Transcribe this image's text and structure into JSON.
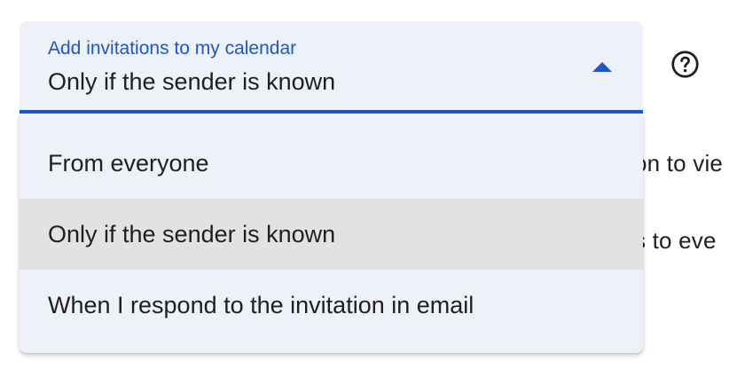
{
  "setting": {
    "label": "Add invitations to my calendar",
    "selected_value": "Only if the sender is known",
    "options": [
      "From everyone",
      "Only if the sender is known",
      "When I respond to the invitation in email"
    ]
  },
  "background": {
    "line_1": "on to vie",
    "line_2": "s to eve"
  },
  "icons": {
    "help": "help-circle-icon",
    "caret": "arrow-drop-up-icon"
  },
  "colors": {
    "accent": "#1d56c9",
    "field_background": "#eef1f8",
    "selected_option_background": "#e1e2e1",
    "text": "#1f1f1f"
  }
}
